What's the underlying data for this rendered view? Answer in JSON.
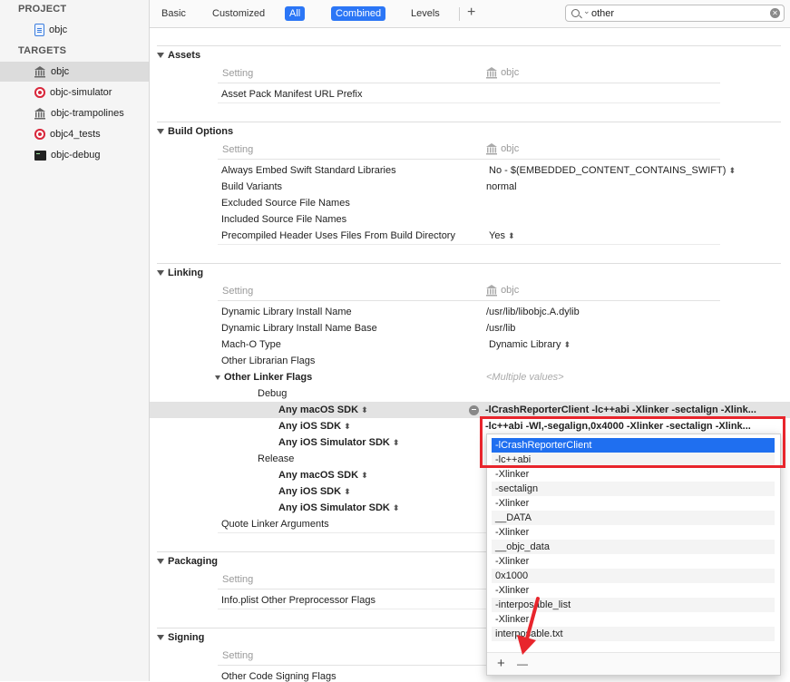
{
  "sidebar": {
    "project_header": "PROJECT",
    "project": "objc",
    "targets_header": "TARGETS",
    "targets": [
      {
        "label": "objc",
        "icon": "library-icon",
        "selected": true
      },
      {
        "label": "objc-simulator",
        "icon": "target-icon"
      },
      {
        "label": "objc-trampolines",
        "icon": "library-icon"
      },
      {
        "label": "objc4_tests",
        "icon": "target-icon"
      },
      {
        "label": "objc-debug",
        "icon": "terminal-icon"
      }
    ]
  },
  "toolbar": {
    "basic": "Basic",
    "customized": "Customized",
    "all": "All",
    "combined": "Combined",
    "levels": "Levels",
    "add": "+",
    "search_value": "other"
  },
  "column_header": {
    "setting": "Setting",
    "target": "objc"
  },
  "sections": {
    "assets": {
      "title": "Assets",
      "rows": [
        {
          "name": "Asset Pack Manifest URL Prefix",
          "value": ""
        }
      ]
    },
    "build_options": {
      "title": "Build Options",
      "rows": [
        {
          "name": "Always Embed Swift Standard Libraries",
          "value": "No  -  $(EMBEDDED_CONTENT_CONTAINS_SWIFT)"
        },
        {
          "name": "Build Variants",
          "value": "normal"
        },
        {
          "name": "Excluded Source File Names",
          "value": ""
        },
        {
          "name": "Included Source File Names",
          "value": ""
        },
        {
          "name": "Precompiled Header Uses Files From Build Directory",
          "value": "Yes"
        }
      ]
    },
    "linking": {
      "title": "Linking",
      "rows": [
        {
          "name": "Dynamic Library Install Name",
          "value": "/usr/lib/libobjc.A.dylib"
        },
        {
          "name": "Dynamic Library Install Name Base",
          "value": "/usr/lib"
        },
        {
          "name": "Mach-O Type",
          "value": "Dynamic Library"
        },
        {
          "name": "Other Librarian Flags",
          "value": ""
        },
        {
          "name": "Other Linker Flags",
          "value": "<Multiple values>"
        },
        {
          "name": "Debug",
          "value": ""
        },
        {
          "name": "Any macOS SDK",
          "value": "-lCrashReporterClient -lc++abi -Xlinker -sectalign -Xlink..."
        },
        {
          "name": "Any iOS SDK",
          "value": "-lc++abi -Wl,-segalign,0x4000 -Xlinker -sectalign -Xlink..."
        },
        {
          "name": "Any iOS Simulator SDK",
          "value": ""
        },
        {
          "name": "Release",
          "value": ""
        },
        {
          "name": "Any macOS SDK",
          "value": ""
        },
        {
          "name": "Any iOS SDK",
          "value": ""
        },
        {
          "name": "Any iOS Simulator SDK",
          "value": ""
        },
        {
          "name": "Quote Linker Arguments",
          "value": ""
        }
      ]
    },
    "packaging": {
      "title": "Packaging",
      "rows": [
        {
          "name": "Info.plist Other Preprocessor Flags",
          "value": ""
        }
      ]
    },
    "signing": {
      "title": "Signing",
      "rows": [
        {
          "name": "Other Code Signing Flags",
          "value": ""
        }
      ]
    }
  },
  "popover": {
    "items": [
      "-lCrashReporterClient",
      "-lc++abi",
      "-Xlinker",
      "-sectalign",
      "-Xlinker",
      "__DATA",
      "-Xlinker",
      "__objc_data",
      "-Xlinker",
      "0x1000",
      "-Xlinker",
      "-interposable_list",
      "-Xlinker",
      "interposable.txt"
    ],
    "add": "+",
    "remove": "—"
  },
  "colors": {
    "accent": "#2b76f6",
    "selection": "#1f6ff0",
    "annotation": "#e8252c"
  }
}
